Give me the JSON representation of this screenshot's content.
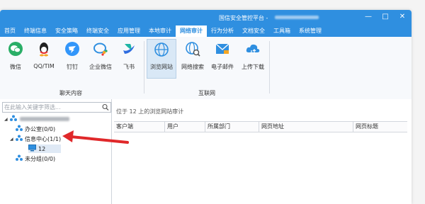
{
  "window": {
    "title": "国信安全管控平台 -",
    "controls": [
      "—",
      "□",
      "✕"
    ]
  },
  "menu": {
    "tabs": [
      {
        "label": "首页",
        "active": false
      },
      {
        "label": "终端信息",
        "active": false
      },
      {
        "label": "安全策略",
        "active": false
      },
      {
        "label": "终端安全",
        "active": false
      },
      {
        "label": "应用管理",
        "active": false
      },
      {
        "label": "本地审计",
        "active": false
      },
      {
        "label": "网络审计",
        "active": true
      },
      {
        "label": "行为分析",
        "active": false
      },
      {
        "label": "文档安全",
        "active": false
      },
      {
        "label": "工具箱",
        "active": false
      },
      {
        "label": "系统管理",
        "active": false
      }
    ]
  },
  "ribbon": {
    "groups": [
      {
        "label": "聊天内容"
      },
      {
        "label": "互联网"
      }
    ],
    "tools": [
      {
        "label": "微信",
        "icon": "wechat-icon",
        "color": "#2aae67"
      },
      {
        "label": "QQ/TIM",
        "icon": "qq-icon",
        "color": "#222222"
      },
      {
        "label": "钉钉",
        "icon": "dingtalk-icon",
        "color": "#3296fa"
      },
      {
        "label": "企业微信",
        "icon": "wecom-icon",
        "color": "#2f8fe0"
      },
      {
        "label": "飞书",
        "icon": "feishu-icon",
        "color": "#1fb5a5"
      },
      {
        "label": "浏览网站",
        "icon": "globe-icon",
        "color": "#2f8fe0"
      },
      {
        "label": "网络搜索",
        "icon": "globe-search-icon",
        "color": "#2f8fe0"
      },
      {
        "label": "电子邮件",
        "icon": "mail-icon",
        "color": "#2f8fe0"
      },
      {
        "label": "上传下载",
        "icon": "cloud-transfer-icon",
        "color": "#2f8fe0"
      }
    ]
  },
  "tree": {
    "search_placeholder": "在此输入关键字筛选...",
    "nodes": [
      {
        "label": "办公室(0/0)",
        "toggle": "▸"
      },
      {
        "label": "信息中心(1/1)",
        "toggle": "◢"
      },
      {
        "label": "12",
        "toggle": ""
      },
      {
        "label": "未分组(0/0)",
        "toggle": ""
      }
    ]
  },
  "main": {
    "path": "位于 12 上的浏览网站审计",
    "columns": [
      "客户端",
      "用户",
      "所属部门",
      "网页地址",
      "网页标题"
    ]
  },
  "colors": {
    "accent": "#2f8fe0",
    "annotation": "#e0282a"
  }
}
